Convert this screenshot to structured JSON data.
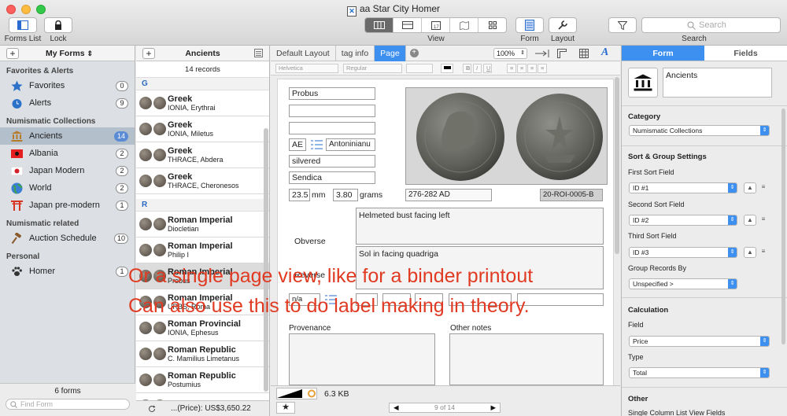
{
  "window": {
    "title": "aa Star City Homer",
    "doc_icon": "✕"
  },
  "toolbar": {
    "forms_list": "Forms List",
    "lock": "Lock",
    "view": "View",
    "form": "Form",
    "layout": "Layout",
    "search_label": "Search",
    "search_placeholder": "Search"
  },
  "sidebar": {
    "header": "My Forms",
    "sections": {
      "favorites": "Favorites & Alerts",
      "numismatic": "Numismatic Collections",
      "related": "Numismatic related",
      "personal": "Personal"
    },
    "items": [
      {
        "label": "Favorites",
        "count": "0"
      },
      {
        "label": "Alerts",
        "count": "9"
      },
      {
        "label": "Ancients",
        "count": "14"
      },
      {
        "label": "Albania",
        "count": "2"
      },
      {
        "label": "Japan Modern",
        "count": "2"
      },
      {
        "label": "World",
        "count": "2"
      },
      {
        "label": "Japan pre-modern",
        "count": "1"
      },
      {
        "label": "Auction Schedule",
        "count": "10"
      },
      {
        "label": "Homer",
        "count": "1"
      }
    ],
    "footer_count": "6 forms",
    "find_placeholder": "Find Form"
  },
  "list": {
    "header": "Ancients",
    "records": "14 records",
    "group_g": "G",
    "group_r": "R",
    "footer": "...(Price): US$3,650.22",
    "rows": [
      {
        "title": "Greek",
        "sub": "IONIA, Erythrai"
      },
      {
        "title": "Greek",
        "sub": "IONIA, Miletus"
      },
      {
        "title": "Greek",
        "sub": "THRACE, Abdera"
      },
      {
        "title": "Greek",
        "sub": "THRACE, Cheronesos"
      },
      {
        "title": "Roman Imperial",
        "sub": "Diocletian"
      },
      {
        "title": "Roman Imperial",
        "sub": "Philip I"
      },
      {
        "title": "Roman Imperial",
        "sub": "Probus"
      },
      {
        "title": "Roman Imperial",
        "sub": "URBS, Roma"
      },
      {
        "title": "Roman Provincial",
        "sub": "IONIA, Ephesus"
      },
      {
        "title": "Roman Republic",
        "sub": "C. Mamilius Limetanus"
      },
      {
        "title": "Roman Republic",
        "sub": "Postumius"
      },
      {
        "title": "Roman Republic",
        "sub": ""
      }
    ]
  },
  "main": {
    "tabs": [
      "Default Layout",
      "tag info",
      "Page"
    ],
    "zoom": "100%",
    "font": "Helvetica",
    "style": "Regular",
    "bold": "B",
    "italic": "I",
    "underline": "U",
    "fields": {
      "name": "Probus",
      "denom": "AE",
      "type": "Antoninianu",
      "metal": "silvered",
      "mint": "Sendica",
      "size": "23.5",
      "size_unit": "mm",
      "weight": "3.80",
      "weight_unit": "grams",
      "date": "276-282 AD",
      "ref": "20-ROI-0005-B",
      "obverse_label": "Obverse",
      "obverse": "Helmeted bust facing left",
      "reverse_label": "Reverse",
      "reverse": "Sol in facing quadriga",
      "na": "n/a",
      "provenance": "Provenance",
      "other_notes": "Other notes"
    },
    "file_size": "6.3 KB",
    "pager": "9 of 14"
  },
  "right": {
    "tabs": [
      "Form",
      "Fields"
    ],
    "form_name": "Ancients",
    "category_label": "Category",
    "category": "Numismatic Collections",
    "sort_section": "Sort & Group Settings",
    "first_sort": "First Sort Field",
    "first_val": "ID #1",
    "second_sort": "Second Sort Field",
    "second_val": "ID #2",
    "third_sort": "Third Sort Field",
    "third_val": "ID #3",
    "group_by": "Group Records By",
    "group_val": "Unspecified >",
    "calc_section": "Calculation",
    "field_label": "Field",
    "field_val": "Price",
    "type_label": "Type",
    "type_val": "Total",
    "other_section": "Other",
    "single_col": "Single Column List View Fields"
  },
  "overlay": {
    "line1": "Or a single page view, like for a binder printout",
    "line2": "Can also use this to do label making in theory."
  },
  "colors": {
    "accent": "#3d8ff0",
    "overlay": "#e03a22"
  }
}
